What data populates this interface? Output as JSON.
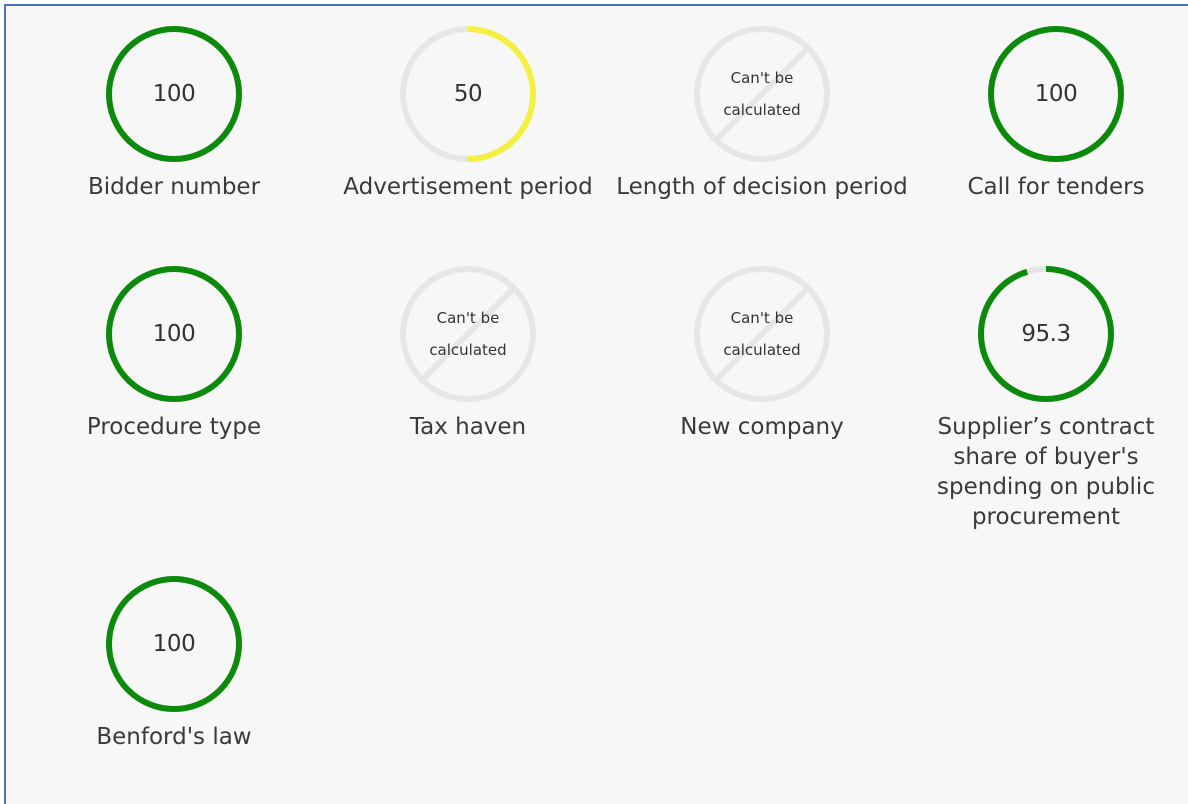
{
  "colors": {
    "track": "#e6e6e6",
    "green": "#0b8a0b",
    "yellow": "#f4f043",
    "panel_bg": "#f7f7f7",
    "frame": "#4a72c8"
  },
  "indicators": [
    {
      "name": "Bidder number",
      "value": "100",
      "fraction": 1.0,
      "color": "#0b8a0b",
      "available": true
    },
    {
      "name": "Advertisement period",
      "value": "50",
      "fraction": 0.5,
      "color": "#f4f043",
      "available": true
    },
    {
      "name": "Length of decision period",
      "value": null,
      "fraction": 0,
      "available": false,
      "na_line1": "Can't be",
      "na_line2": "calculated"
    },
    {
      "name": "Call for tenders",
      "value": "100",
      "fraction": 1.0,
      "color": "#0b8a0b",
      "available": true
    },
    {
      "name": "Procedure type",
      "value": "100",
      "fraction": 1.0,
      "color": "#0b8a0b",
      "available": true
    },
    {
      "name": "Tax haven",
      "value": null,
      "fraction": 0,
      "available": false,
      "na_line1": "Can't be",
      "na_line2": "calculated"
    },
    {
      "name": "New company",
      "value": null,
      "fraction": 0,
      "available": false,
      "na_line1": "Can't be",
      "na_line2": "calculated"
    },
    {
      "name": "Supplier’s contract share of buyer's spending on public procurement",
      "value": "95.3",
      "fraction": 0.953,
      "color": "#0b8a0b",
      "available": true
    },
    {
      "name": "Benford's law",
      "value": "100",
      "fraction": 1.0,
      "color": "#0b8a0b",
      "available": true
    }
  ]
}
